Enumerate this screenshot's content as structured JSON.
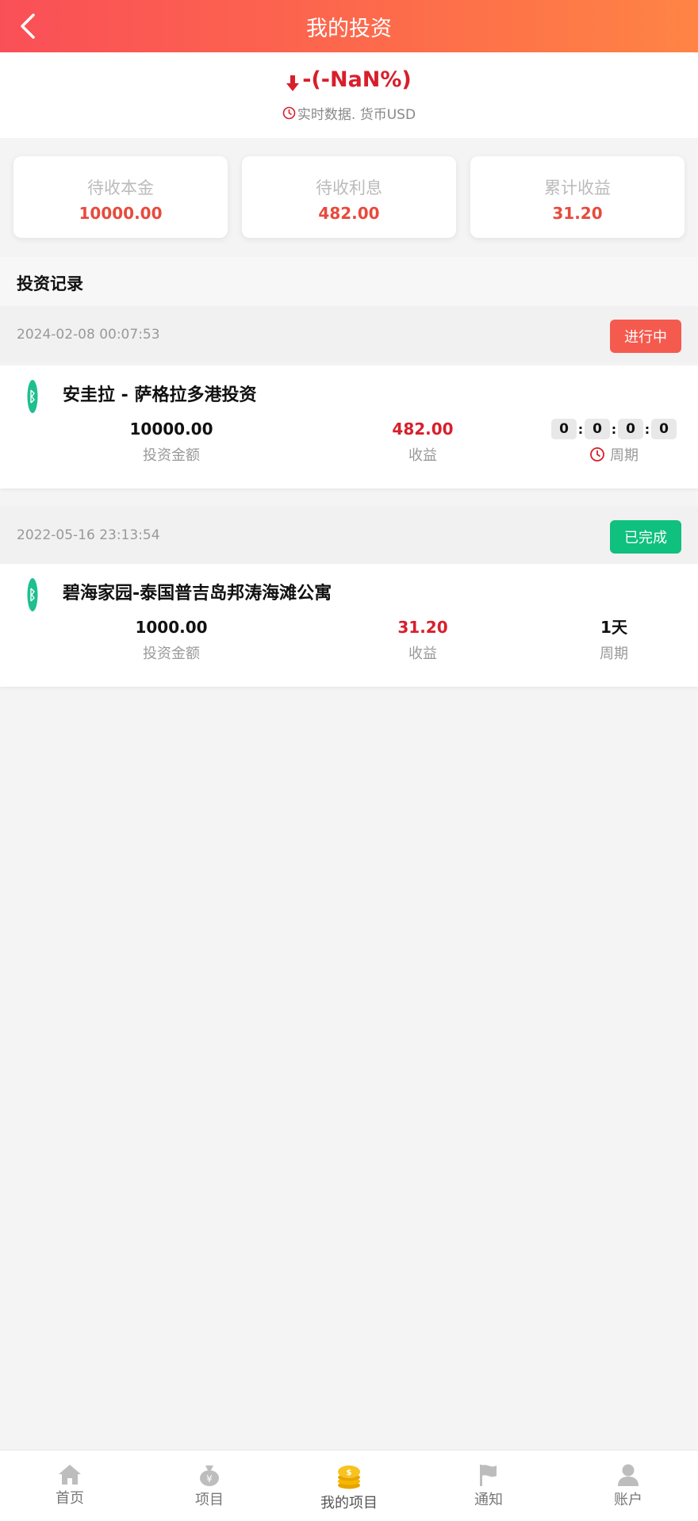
{
  "header": {
    "title": "我的投资"
  },
  "summary": {
    "rate_text": "-(-NaN%)",
    "realtime_text": "实时数据. 货币USD"
  },
  "cards": [
    {
      "label": "待收本金",
      "value": "10000.00"
    },
    {
      "label": "待收利息",
      "value": "482.00"
    },
    {
      "label": "累计收益",
      "value": "31.20"
    }
  ],
  "records_title": "投资记录",
  "records": [
    {
      "date": "2024-02-08 00:07:53",
      "status": "进行中",
      "status_color": "#f55a4e",
      "name": "安圭拉 - 萨格拉多港投资",
      "amount": "10000.00",
      "amount_label": "投资金额",
      "income": "482.00",
      "income_label": "收益",
      "timer": [
        "0",
        "0",
        "0",
        "0"
      ],
      "period_label": "周期"
    },
    {
      "date": "2022-05-16 23:13:54",
      "status": "已完成",
      "status_color": "#0fc07e",
      "name": "碧海家园-泰国普吉岛邦涛海滩公寓",
      "amount": "1000.00",
      "amount_label": "投资金额",
      "income": "31.20",
      "income_label": "收益",
      "period": "1天",
      "period_label": "周期"
    }
  ],
  "tabbar": [
    {
      "label": "首页",
      "icon": "home-icon"
    },
    {
      "label": "项目",
      "icon": "money-bag-icon"
    },
    {
      "label": "我的项目",
      "icon": "coins-icon",
      "active": true
    },
    {
      "label": "通知",
      "icon": "flag-icon"
    },
    {
      "label": "账户",
      "icon": "user-icon"
    }
  ],
  "colors": {
    "header_start": "#fa4f57",
    "header_end": "#ff8445",
    "accent_red": "#d81f2b",
    "logo_green": "#1fbf8f"
  }
}
